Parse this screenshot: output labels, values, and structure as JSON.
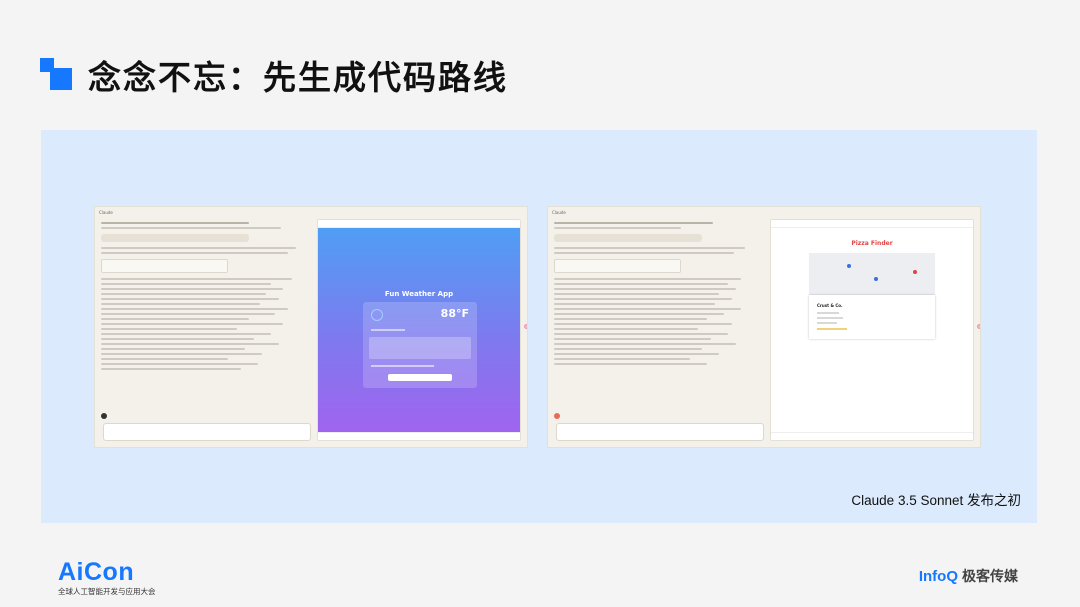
{
  "slide": {
    "title": "念念不忘：先生成代码路线",
    "caption": "Claude 3.5 Sonnet 发布之初"
  },
  "left_screenshot": {
    "app_label": "Claude",
    "preview_title": "Fun Weather App",
    "temperature": "88°F"
  },
  "right_screenshot": {
    "app_label": "Claude",
    "preview_title": "Pizza Finder",
    "card_name": "Crust & Co."
  },
  "footer": {
    "aicon_logo": "AiCon",
    "aicon_sub": "全球人工智能开发与应用大会",
    "infoq_logo": "InfoQ",
    "infoq_sub": "极客传媒"
  },
  "colors": {
    "accent": "#1677ff",
    "panel_bg": "#dbeafc",
    "pizza_red": "#e24343"
  }
}
